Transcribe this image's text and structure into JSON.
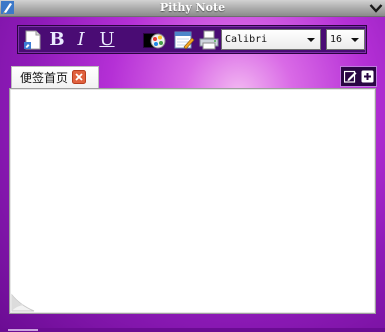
{
  "window": {
    "title": "Pithy Note",
    "app_icon": "pen-icon",
    "collapse_icon": "chevron-down-icon"
  },
  "toolbar": {
    "new_icon": "new-note-icon",
    "bold_label": "B",
    "italic_label": "I",
    "underline_label": "U",
    "color_swatch": "#000000",
    "paint_icon": "paint-bucket-icon",
    "calendar_icon": "calendar-edit-icon",
    "print_icon": "printer-icon",
    "font_family": "Calibri",
    "font_size": "16"
  },
  "tabs": [
    {
      "label": "便签首页",
      "close_icon": "close-icon"
    }
  ],
  "tab_tools": {
    "edit_icon": "edit-icon",
    "add_icon": "add-icon"
  },
  "editor": {
    "content": "",
    "corner_icon": "page-curl-icon"
  },
  "colors": {
    "background_top": "#f3b9f2",
    "background_mid": "#b530d6",
    "background_deep": "#6b0c93",
    "toolbar_bg": "#4a0c74",
    "titlebar": "#a9a9a9",
    "tab_close": "#e0613e"
  }
}
